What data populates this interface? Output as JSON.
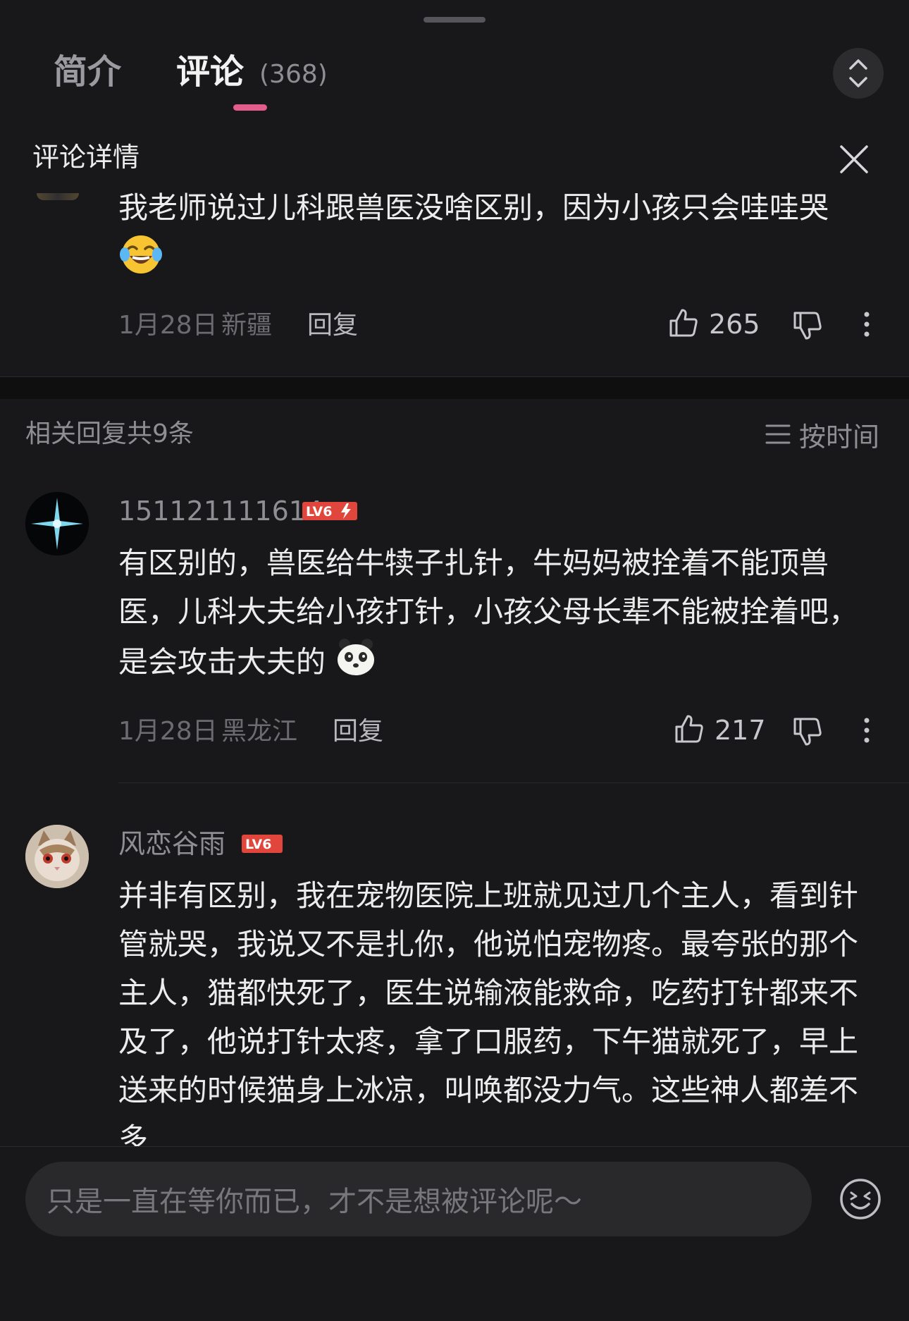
{
  "tabs": {
    "intro_label": "简介",
    "comments_label": "评论",
    "comments_count": "(368)"
  },
  "detail": {
    "title": "评论详情"
  },
  "main_comment": {
    "text": "我老师说过儿科跟兽医没啥区别，因为小孩只会哇哇哭",
    "emoji_icon": "laughing-tears-emoji",
    "date": "1月28日",
    "location": "新疆",
    "reply_label": "回复",
    "likes": "265"
  },
  "replies_header": {
    "total_label": "相关回复共9条",
    "sort_label": "按时间"
  },
  "replies": [
    {
      "username": "151121111614",
      "level": "LV6",
      "level_color": "#e0463c",
      "text": "有区别的，兽医给牛犊子扎针，牛妈妈被拴着不能顶兽医，儿科大夫给小孩打针，小孩父母长辈不能被拴着吧，是会攻击大夫的",
      "emoji_icon": "panda-face-emoji",
      "date": "1月28日",
      "location": "黑龙江",
      "reply_label": "回复",
      "likes": "217"
    },
    {
      "username": "风恋谷雨",
      "level": "LV6",
      "level_color": "#e0463c",
      "text": "并非有区别，我在宠物医院上班就见过几个主人，看到针管就哭，我说又不是扎你，他说怕宠物疼。最夸张的那个主人，猫都快死了，医生说输液能救命，吃药打针都来不及了，他说打针太疼，拿了口服药，下午猫就死了，早上送来的时候猫身上冰凉，叫唤都没力气。这些神人都差不多"
    }
  ],
  "input": {
    "placeholder": "只是一直在等你而已，才不是想被评论呢～"
  },
  "colors": {
    "background": "#18181a",
    "accent_pink": "#e45c8a",
    "level_badge": "#e0463c"
  }
}
